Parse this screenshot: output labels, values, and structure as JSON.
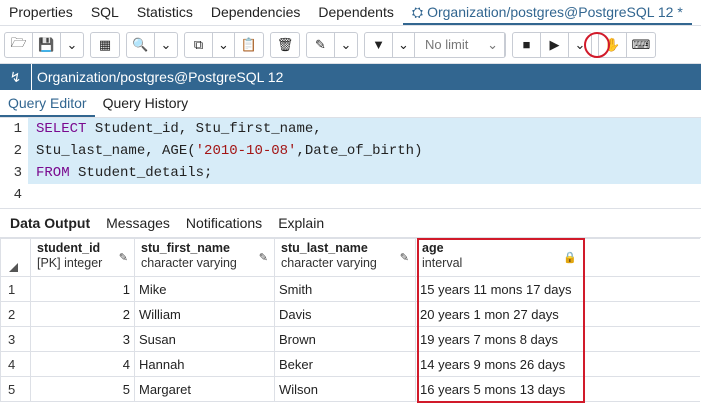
{
  "tabs": [
    "Properties",
    "SQL",
    "Statistics",
    "Dependencies",
    "Dependents"
  ],
  "active_tab": "Organization/postgres@PostgreSQL 12 *",
  "toolbar": {
    "limit_label": "No limit"
  },
  "connection": "Organization/postgres@PostgreSQL 12",
  "subtabs": [
    "Query Editor",
    "Query History"
  ],
  "editor": {
    "lines": [
      {
        "n": "1",
        "parts": [
          {
            "t": "SELECT",
            "k": "kw"
          },
          {
            "t": " Student_id, Stu_first_name,",
            "k": "grey"
          }
        ]
      },
      {
        "n": "2",
        "parts": [
          {
            "t": "Stu_last_name, AGE(",
            "k": "grey"
          },
          {
            "t": "'2010-10-08'",
            "k": "str"
          },
          {
            "t": ",Date_of_birth)",
            "k": "grey"
          }
        ]
      },
      {
        "n": "3",
        "parts": [
          {
            "t": "FROM",
            "k": "kw"
          },
          {
            "t": " Student_details;",
            "k": "grey"
          }
        ]
      },
      {
        "n": "4",
        "parts": []
      }
    ]
  },
  "output_tabs": [
    "Data Output",
    "Messages",
    "Notifications",
    "Explain"
  ],
  "columns": [
    {
      "name": "student_id",
      "type": "[PK] integer",
      "icon": "pencil-icon"
    },
    {
      "name": "stu_first_name",
      "type": "character varying",
      "icon": "pencil-icon"
    },
    {
      "name": "stu_last_name",
      "type": "character varying",
      "icon": "pencil-icon"
    },
    {
      "name": "age",
      "type": "interval",
      "icon": "lock-icon"
    }
  ],
  "rows": [
    [
      "1",
      "1",
      "Mike",
      "Smith",
      "15 years 11 mons 17 days"
    ],
    [
      "2",
      "2",
      "William",
      "Davis",
      "20 years 1 mon 27 days"
    ],
    [
      "3",
      "3",
      "Susan",
      "Brown",
      "19 years 7 mons 8 days"
    ],
    [
      "4",
      "4",
      "Hannah",
      "Beker",
      "14 years 9 mons 26 days"
    ],
    [
      "5",
      "5",
      "Margaret",
      "Wilson",
      "16 years 5 mons 13 days"
    ]
  ],
  "colors": {
    "accent": "#326690",
    "highlight": "#d11a2a",
    "keyword": "#7a0a8f",
    "string": "#a31515",
    "selection": "#d7ecf8"
  }
}
